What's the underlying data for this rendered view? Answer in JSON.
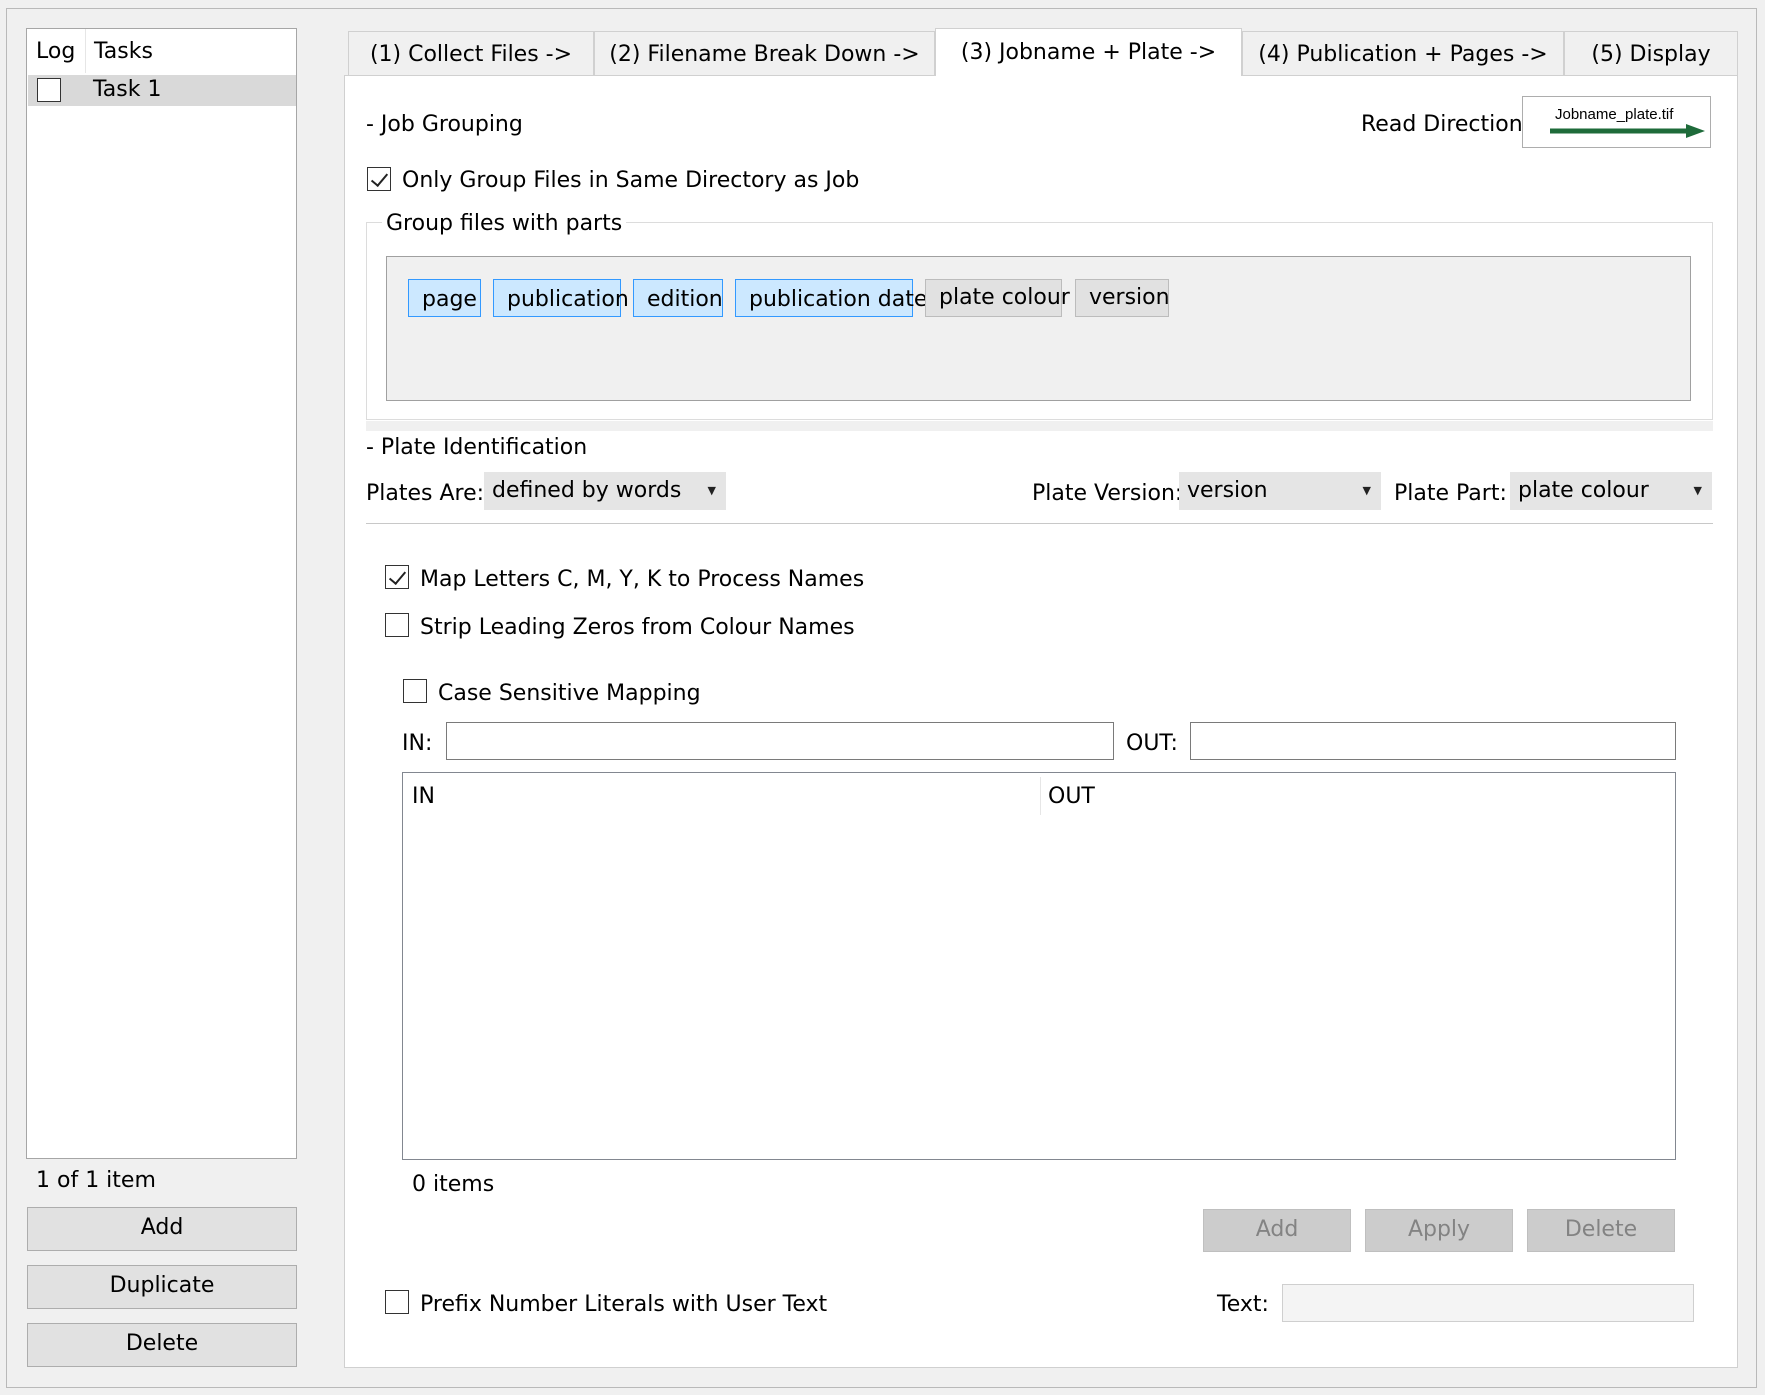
{
  "sidebar": {
    "col_log": "Log",
    "col_tasks": "Tasks",
    "tasks": [
      {
        "label": "Task 1",
        "checked": false
      }
    ],
    "item_count": "1 of 1 item",
    "add_label": "Add",
    "duplicate_label": "Duplicate",
    "delete_label": "Delete"
  },
  "tabs": [
    {
      "label": "(1) Collect Files ->",
      "active": false
    },
    {
      "label": "(2) Filename Break Down ->",
      "active": false
    },
    {
      "label": "(3) Jobname + Plate ->",
      "active": true
    },
    {
      "label": "(4) Publication + Pages ->",
      "active": false
    },
    {
      "label": "(5) Display",
      "active": false
    }
  ],
  "job_grouping": {
    "heading": "- Job Grouping",
    "read_direction_label": "Read Direction:",
    "read_direction_file": "Jobname_plate.tif",
    "arrow_color": "#1e6b3a",
    "only_group_label": "Only Group Files in Same Directory as Job",
    "only_group_checked": true,
    "group_parts_title": "Group files with parts",
    "parts": [
      {
        "label": "page",
        "selected": true
      },
      {
        "label": "publication",
        "selected": true
      },
      {
        "label": "edition",
        "selected": true
      },
      {
        "label": "publication date",
        "selected": true
      },
      {
        "label": "plate colour",
        "selected": false
      },
      {
        "label": "version",
        "selected": false
      }
    ]
  },
  "plate_identification": {
    "heading": "- Plate Identification",
    "plates_are_label": "Plates Are:",
    "plates_are_value": "defined by words",
    "plate_version_label": "Plate Version:",
    "plate_version_value": "version",
    "plate_part_label": "Plate Part:",
    "plate_part_value": "plate colour",
    "map_letters_label": "Map Letters C, M, Y, K to Process Names",
    "map_letters_checked": true,
    "strip_zeros_label": "Strip Leading Zeros from Colour Names",
    "strip_zeros_checked": false,
    "case_sensitive_label": "Case Sensitive Mapping",
    "case_sensitive_checked": false,
    "in_label": "IN:",
    "in_value": "",
    "out_label": "OUT:",
    "out_value": "",
    "table_columns": [
      "IN",
      "OUT"
    ],
    "table_count": "0 items",
    "add_label": "Add",
    "apply_label": "Apply",
    "delete_label": "Delete",
    "prefix_label": "Prefix Number Literals with User Text",
    "prefix_checked": false,
    "text_label": "Text:",
    "text_value": ""
  },
  "colors": {
    "selected_part_bg": "#cce8ff",
    "selected_part_border": "#3399ff",
    "task_row_selected": "#d9d9d9"
  }
}
